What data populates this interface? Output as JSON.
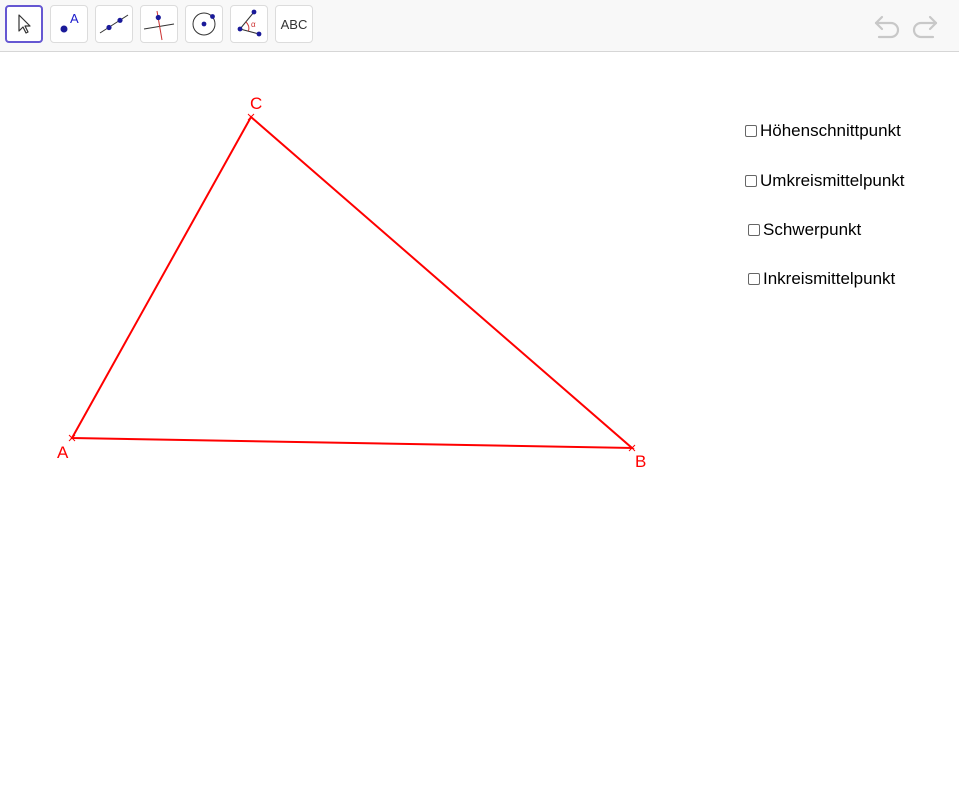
{
  "toolbar": {
    "tools": [
      {
        "icon": "move-arrow-icon",
        "active": true
      },
      {
        "icon": "point-icon",
        "label": "A"
      },
      {
        "icon": "line-icon"
      },
      {
        "icon": "perpendicular-line-icon"
      },
      {
        "icon": "circle-icon"
      },
      {
        "icon": "angle-icon",
        "label": "α"
      },
      {
        "icon": "text-tool-icon",
        "label": "ABC"
      }
    ],
    "undo_icon": "undo-icon",
    "redo_icon": "redo-icon"
  },
  "construction": {
    "color": "#ff0000",
    "points": {
      "A": {
        "label": "A"
      },
      "B": {
        "label": "B"
      },
      "C": {
        "label": "C"
      }
    }
  },
  "checkboxes": [
    {
      "label": "Höhenschnittpunkt",
      "checked": false
    },
    {
      "label": "Umkreismittelpunkt",
      "checked": false
    },
    {
      "label": "Schwerpunkt",
      "checked": false
    },
    {
      "label": "Inkreismittelpunkt",
      "checked": false
    }
  ],
  "colors": {
    "accent": "#6557d2",
    "point_blue": "#1a1a99",
    "construction_red": "#ff0000"
  }
}
